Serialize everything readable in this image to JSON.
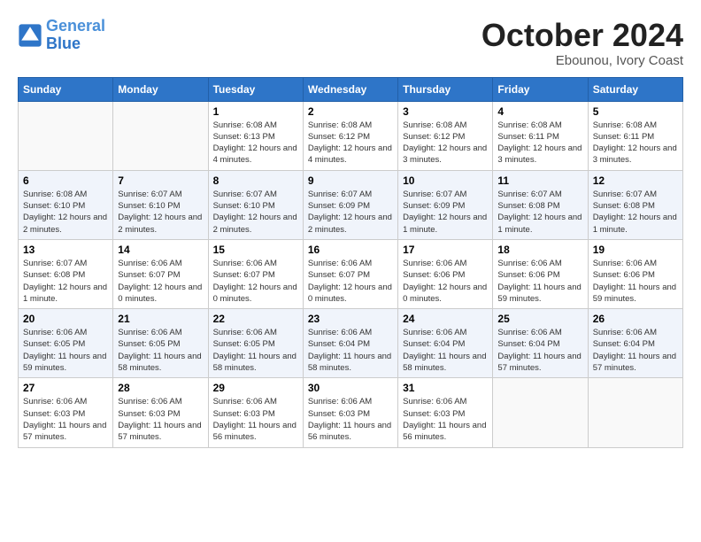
{
  "header": {
    "logo_line1": "General",
    "logo_line2": "Blue",
    "month": "October 2024",
    "location": "Ebounou, Ivory Coast"
  },
  "weekdays": [
    "Sunday",
    "Monday",
    "Tuesday",
    "Wednesday",
    "Thursday",
    "Friday",
    "Saturday"
  ],
  "weeks": [
    [
      {
        "day": "",
        "info": ""
      },
      {
        "day": "",
        "info": ""
      },
      {
        "day": "1",
        "info": "Sunrise: 6:08 AM\nSunset: 6:13 PM\nDaylight: 12 hours and 4 minutes."
      },
      {
        "day": "2",
        "info": "Sunrise: 6:08 AM\nSunset: 6:12 PM\nDaylight: 12 hours and 4 minutes."
      },
      {
        "day": "3",
        "info": "Sunrise: 6:08 AM\nSunset: 6:12 PM\nDaylight: 12 hours and 3 minutes."
      },
      {
        "day": "4",
        "info": "Sunrise: 6:08 AM\nSunset: 6:11 PM\nDaylight: 12 hours and 3 minutes."
      },
      {
        "day": "5",
        "info": "Sunrise: 6:08 AM\nSunset: 6:11 PM\nDaylight: 12 hours and 3 minutes."
      }
    ],
    [
      {
        "day": "6",
        "info": "Sunrise: 6:08 AM\nSunset: 6:10 PM\nDaylight: 12 hours and 2 minutes."
      },
      {
        "day": "7",
        "info": "Sunrise: 6:07 AM\nSunset: 6:10 PM\nDaylight: 12 hours and 2 minutes."
      },
      {
        "day": "8",
        "info": "Sunrise: 6:07 AM\nSunset: 6:10 PM\nDaylight: 12 hours and 2 minutes."
      },
      {
        "day": "9",
        "info": "Sunrise: 6:07 AM\nSunset: 6:09 PM\nDaylight: 12 hours and 2 minutes."
      },
      {
        "day": "10",
        "info": "Sunrise: 6:07 AM\nSunset: 6:09 PM\nDaylight: 12 hours and 1 minute."
      },
      {
        "day": "11",
        "info": "Sunrise: 6:07 AM\nSunset: 6:08 PM\nDaylight: 12 hours and 1 minute."
      },
      {
        "day": "12",
        "info": "Sunrise: 6:07 AM\nSunset: 6:08 PM\nDaylight: 12 hours and 1 minute."
      }
    ],
    [
      {
        "day": "13",
        "info": "Sunrise: 6:07 AM\nSunset: 6:08 PM\nDaylight: 12 hours and 1 minute."
      },
      {
        "day": "14",
        "info": "Sunrise: 6:06 AM\nSunset: 6:07 PM\nDaylight: 12 hours and 0 minutes."
      },
      {
        "day": "15",
        "info": "Sunrise: 6:06 AM\nSunset: 6:07 PM\nDaylight: 12 hours and 0 minutes."
      },
      {
        "day": "16",
        "info": "Sunrise: 6:06 AM\nSunset: 6:07 PM\nDaylight: 12 hours and 0 minutes."
      },
      {
        "day": "17",
        "info": "Sunrise: 6:06 AM\nSunset: 6:06 PM\nDaylight: 12 hours and 0 minutes."
      },
      {
        "day": "18",
        "info": "Sunrise: 6:06 AM\nSunset: 6:06 PM\nDaylight: 11 hours and 59 minutes."
      },
      {
        "day": "19",
        "info": "Sunrise: 6:06 AM\nSunset: 6:06 PM\nDaylight: 11 hours and 59 minutes."
      }
    ],
    [
      {
        "day": "20",
        "info": "Sunrise: 6:06 AM\nSunset: 6:05 PM\nDaylight: 11 hours and 59 minutes."
      },
      {
        "day": "21",
        "info": "Sunrise: 6:06 AM\nSunset: 6:05 PM\nDaylight: 11 hours and 58 minutes."
      },
      {
        "day": "22",
        "info": "Sunrise: 6:06 AM\nSunset: 6:05 PM\nDaylight: 11 hours and 58 minutes."
      },
      {
        "day": "23",
        "info": "Sunrise: 6:06 AM\nSunset: 6:04 PM\nDaylight: 11 hours and 58 minutes."
      },
      {
        "day": "24",
        "info": "Sunrise: 6:06 AM\nSunset: 6:04 PM\nDaylight: 11 hours and 58 minutes."
      },
      {
        "day": "25",
        "info": "Sunrise: 6:06 AM\nSunset: 6:04 PM\nDaylight: 11 hours and 57 minutes."
      },
      {
        "day": "26",
        "info": "Sunrise: 6:06 AM\nSunset: 6:04 PM\nDaylight: 11 hours and 57 minutes."
      }
    ],
    [
      {
        "day": "27",
        "info": "Sunrise: 6:06 AM\nSunset: 6:03 PM\nDaylight: 11 hours and 57 minutes."
      },
      {
        "day": "28",
        "info": "Sunrise: 6:06 AM\nSunset: 6:03 PM\nDaylight: 11 hours and 57 minutes."
      },
      {
        "day": "29",
        "info": "Sunrise: 6:06 AM\nSunset: 6:03 PM\nDaylight: 11 hours and 56 minutes."
      },
      {
        "day": "30",
        "info": "Sunrise: 6:06 AM\nSunset: 6:03 PM\nDaylight: 11 hours and 56 minutes."
      },
      {
        "day": "31",
        "info": "Sunrise: 6:06 AM\nSunset: 6:03 PM\nDaylight: 11 hours and 56 minutes."
      },
      {
        "day": "",
        "info": ""
      },
      {
        "day": "",
        "info": ""
      }
    ]
  ]
}
